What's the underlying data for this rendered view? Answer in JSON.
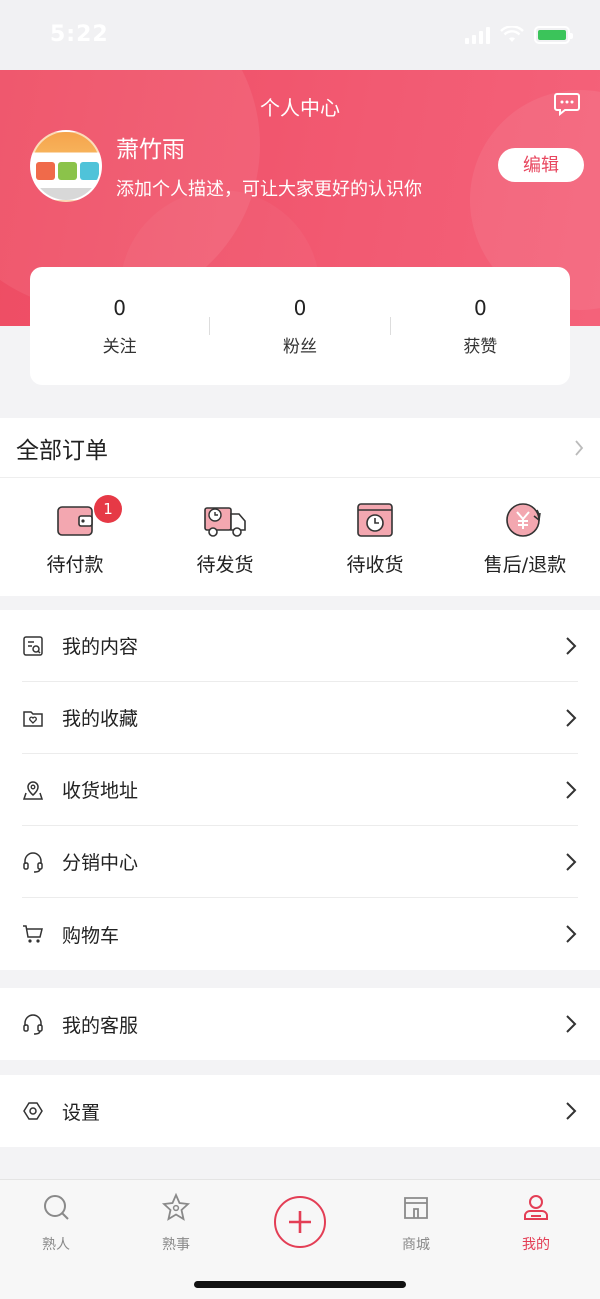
{
  "status": {
    "time": "5:22"
  },
  "header": {
    "title": "个人中心",
    "user_name": "萧竹雨",
    "user_desc": "添加个人描述，可让大家更好的认识你",
    "edit_label": "编辑"
  },
  "stats": [
    {
      "value": "0",
      "label": "关注"
    },
    {
      "value": "0",
      "label": "粉丝"
    },
    {
      "value": "0",
      "label": "获赞"
    }
  ],
  "orders": {
    "title": "全部订单",
    "items": [
      {
        "label": "待付款",
        "icon": "wallet-icon",
        "badge": "1"
      },
      {
        "label": "待发货",
        "icon": "truck-icon"
      },
      {
        "label": "待收货",
        "icon": "clock-box-icon"
      },
      {
        "label": "售后/退款",
        "icon": "yen-refund-icon"
      }
    ]
  },
  "menu": [
    {
      "label": "我的内容",
      "icon": "document-search-icon"
    },
    {
      "label": "我的收藏",
      "icon": "folder-heart-icon"
    },
    {
      "label": "收货地址",
      "icon": "map-pin-icon"
    },
    {
      "label": "分销中心",
      "icon": "headset-icon"
    },
    {
      "label": "购物车",
      "icon": "cart-icon"
    }
  ],
  "menu2": [
    {
      "label": "我的客服",
      "icon": "headset-icon"
    }
  ],
  "menu3": [
    {
      "label": "设置",
      "icon": "gear-icon"
    }
  ],
  "tabs": [
    {
      "label": "熟人",
      "icon": "search-icon"
    },
    {
      "label": "熟事",
      "icon": "star-icon"
    },
    {
      "label": "",
      "icon": "plus-icon"
    },
    {
      "label": "商城",
      "icon": "store-icon"
    },
    {
      "label": "我的",
      "icon": "user-icon",
      "active": true
    }
  ],
  "colors": {
    "accent": "#e33e55",
    "header": "#ef4f67"
  }
}
